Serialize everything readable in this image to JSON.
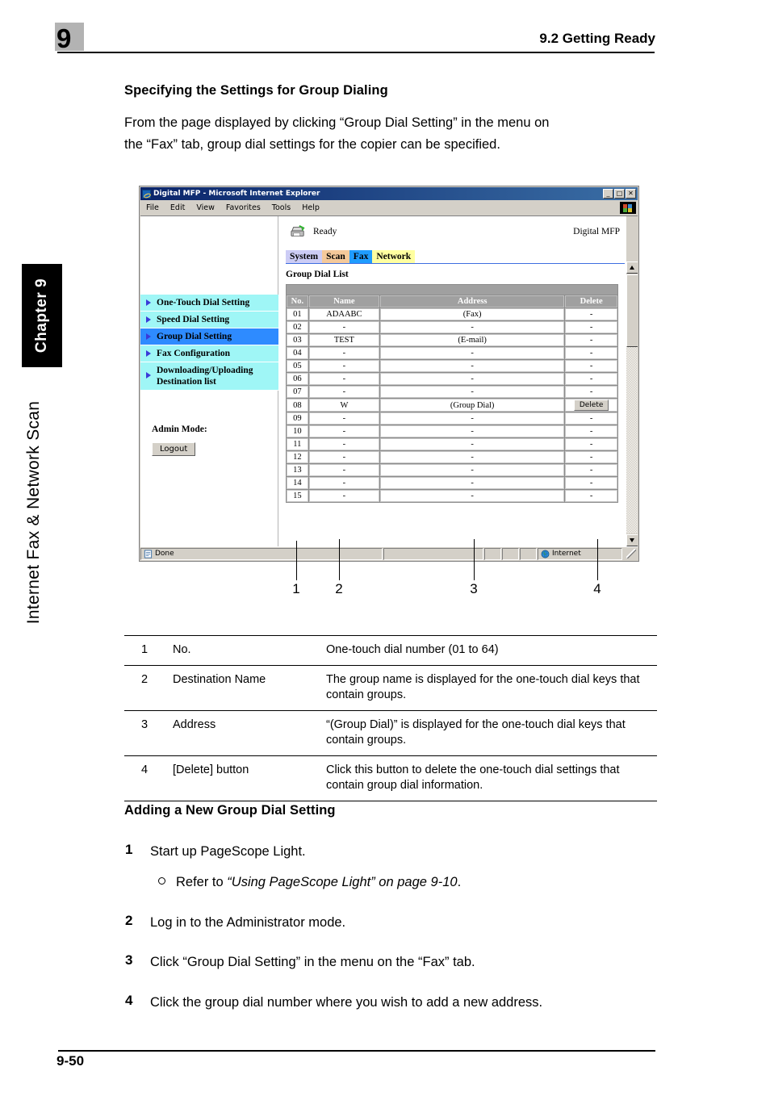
{
  "header": {
    "chapter_number": "9",
    "section_title": "9.2 Getting Ready"
  },
  "rail": {
    "chapter_label": "Chapter 9",
    "part_title": "Internet Fax & Network Scan"
  },
  "content": {
    "heading1": "Specifying the Settings for Group Dialing",
    "paragraph1_line1": "From the page displayed by clicking “Group Dial Setting” in the menu on",
    "paragraph1_line2": "the “Fax” tab, group dial settings for the copier can be specified.",
    "heading2": "Adding a New Group Dial Setting"
  },
  "browser": {
    "title": "Digital MFP - Microsoft Internet Explorer",
    "window_buttons": {
      "minimize": "_",
      "maximize": "□",
      "close": "✕"
    },
    "menus": [
      "File",
      "Edit",
      "View",
      "Favorites",
      "Tools",
      "Help"
    ],
    "status": {
      "ready_text": "Ready",
      "device_name": "Digital MFP",
      "done_text": "Done",
      "zone_text": "Internet"
    },
    "tabs": [
      {
        "label": "System",
        "bg": "#ccccf5",
        "fg": "#000000"
      },
      {
        "label": "Scan",
        "bg": "#f5c99a",
        "fg": "#000000"
      },
      {
        "label": "Fax",
        "bg": "#1f9cff",
        "fg": "#000000"
      },
      {
        "label": "Network",
        "bg": "#ffffa0",
        "fg": "#000000"
      }
    ],
    "nav_items": [
      {
        "label": "One-Touch Dial Setting",
        "selected": false
      },
      {
        "label": "Speed Dial Setting",
        "selected": false
      },
      {
        "label": "Group Dial Setting",
        "selected": true
      },
      {
        "label": "Downloading/Uploading\nDestination list",
        "selected": false
      }
    ],
    "nav_item_3": {
      "label": "Fax Configuration",
      "selected": false
    },
    "nav_item_5_line1": "Downloading/Uploading",
    "nav_item_5_line2": "Destination list",
    "admin_mode_label": "Admin Mode:",
    "logout_label": "Logout",
    "list_title": "Group Dial List",
    "table": {
      "columns": [
        "No.",
        "Name",
        "Address",
        "Delete"
      ],
      "rows": [
        {
          "no": "01",
          "name": "ADAABC",
          "address": "(Fax)",
          "delete": "-"
        },
        {
          "no": "02",
          "name": "-",
          "address": "-",
          "delete": "-"
        },
        {
          "no": "03",
          "name": "TEST",
          "address": "(E-mail)",
          "delete": "-"
        },
        {
          "no": "04",
          "name": "-",
          "address": "-",
          "delete": "-"
        },
        {
          "no": "05",
          "name": "-",
          "address": "-",
          "delete": "-"
        },
        {
          "no": "06",
          "name": "-",
          "address": "-",
          "delete": "-"
        },
        {
          "no": "07",
          "name": "-",
          "address": "-",
          "delete": "-"
        },
        {
          "no": "08",
          "name": "W",
          "address": "(Group Dial)",
          "delete": "Delete"
        },
        {
          "no": "09",
          "name": "-",
          "address": "-",
          "delete": "-"
        },
        {
          "no": "10",
          "name": "-",
          "address": "-",
          "delete": "-"
        },
        {
          "no": "11",
          "name": "-",
          "address": "-",
          "delete": "-"
        },
        {
          "no": "12",
          "name": "-",
          "address": "-",
          "delete": "-"
        },
        {
          "no": "13",
          "name": "-",
          "address": "-",
          "delete": "-"
        },
        {
          "no": "14",
          "name": "-",
          "address": "-",
          "delete": "-"
        },
        {
          "no": "15",
          "name": "-",
          "address": "-",
          "delete": "-"
        }
      ]
    }
  },
  "callouts": [
    {
      "num": "1"
    },
    {
      "num": "2"
    },
    {
      "num": "3"
    },
    {
      "num": "4"
    }
  ],
  "legend": {
    "rows": [
      {
        "num": "1",
        "term": "No.",
        "desc": "One-touch dial number (01 to 64)"
      },
      {
        "num": "2",
        "term": "Destination Name",
        "desc": "The group name is displayed for the one-touch dial keys that contain groups."
      },
      {
        "num": "3",
        "term": "Address",
        "desc": "“(Group Dial)” is displayed for the one-touch dial keys that contain groups."
      },
      {
        "num": "4",
        "term": "[Delete] button",
        "desc": "Click this button to delete the one-touch dial settings that contain group dial information."
      }
    ]
  },
  "steps": {
    "s1_num": "1",
    "s1_text": "Start up PageScope Light.",
    "s1_sub_pre": "Refer to ",
    "s1_sub_italic": "“Using PageScope Light” on page 9-10",
    "s1_sub_post": ".",
    "s2_num": "2",
    "s2_text": "Log in to the Administrator mode.",
    "s3_num": "3",
    "s3_text": "Click “Group Dial Setting” in the menu on the “Fax” tab.",
    "s4_num": "4",
    "s4_text": "Click the group dial number where you wish to add a new address."
  },
  "footer": {
    "page_number": "9-50"
  }
}
